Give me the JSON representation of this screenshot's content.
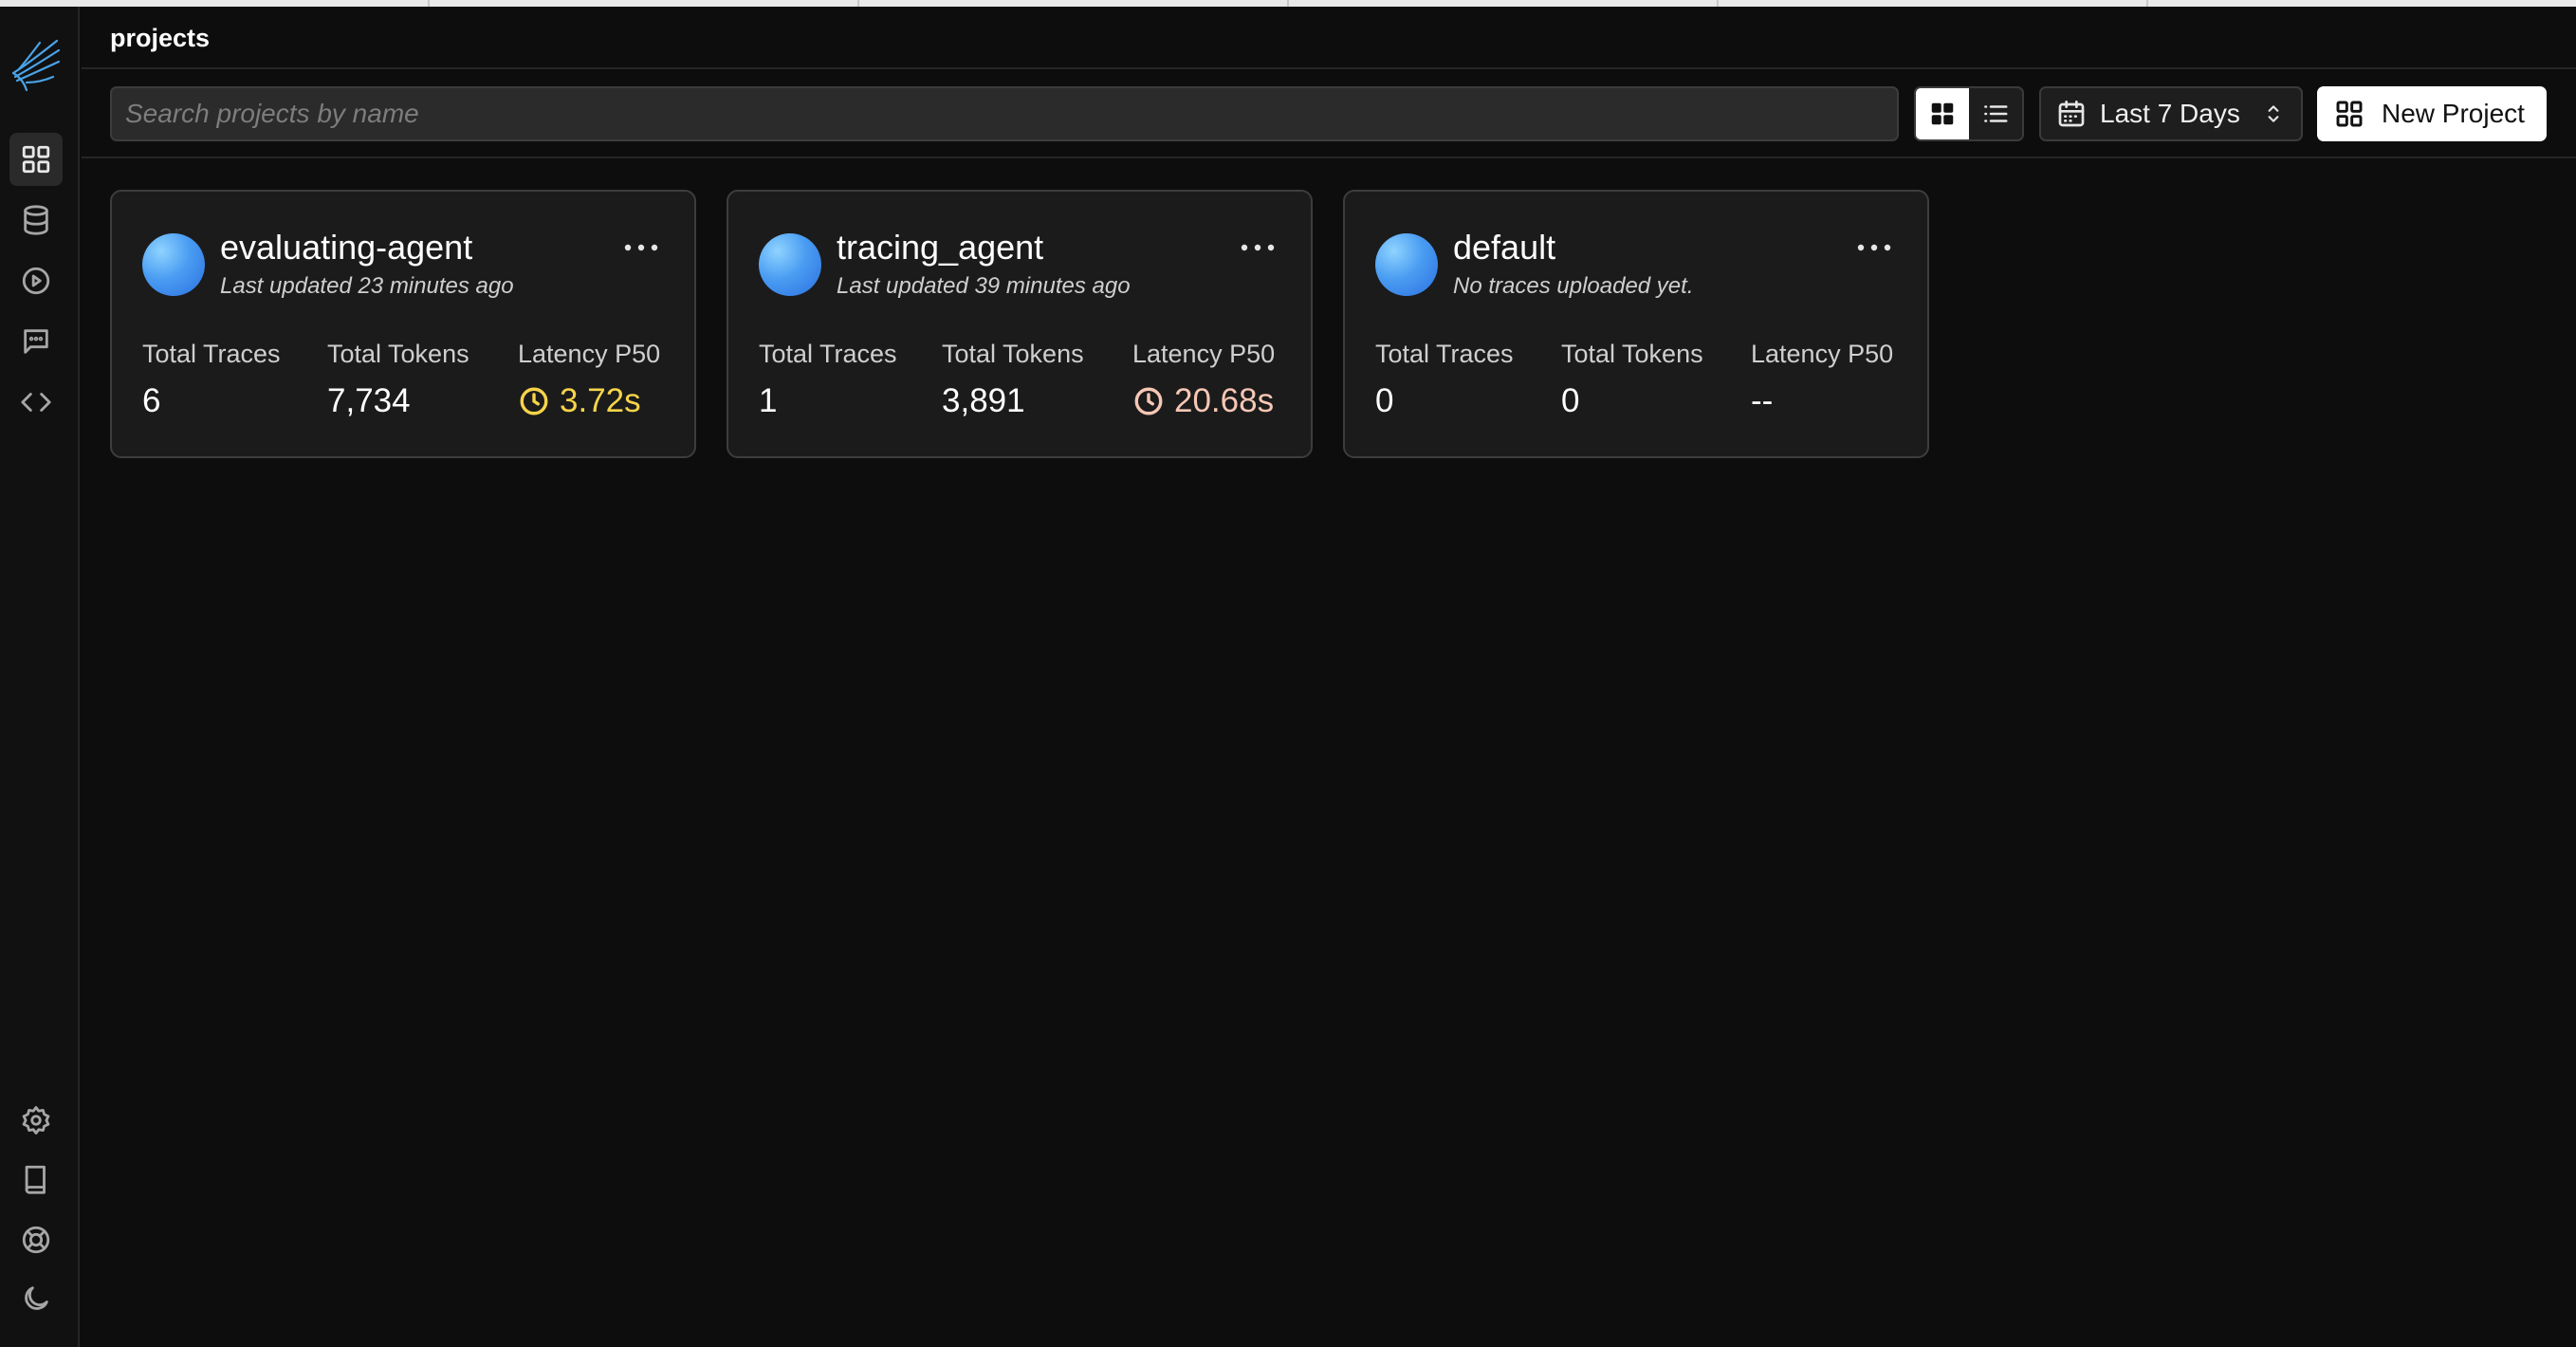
{
  "header": {
    "title": "projects"
  },
  "toolbar": {
    "search_placeholder": "Search projects by name",
    "search_value": "",
    "date_range": "Last 7 Days",
    "new_project_label": "New Project"
  },
  "sidebar": {
    "top_icons": [
      "grid-icon",
      "database-icon",
      "play-circle-icon",
      "message-icon",
      "code-icon"
    ],
    "bottom_icons": [
      "settings-icon",
      "book-icon",
      "lifebuoy-icon",
      "moon-icon"
    ]
  },
  "metric_labels": {
    "traces": "Total Traces",
    "tokens": "Total Tokens",
    "latency": "Latency P50"
  },
  "projects": [
    {
      "name": "evaluating-agent",
      "subtitle": "Last updated 23 minutes ago",
      "total_traces": "6",
      "total_tokens": "7,734",
      "latency": "3.72s",
      "latency_color": "#f6d44a"
    },
    {
      "name": "tracing_agent",
      "subtitle": "Last updated 39 minutes ago",
      "total_traces": "1",
      "total_tokens": "3,891",
      "latency": "20.68s",
      "latency_color": "#f7c7b5"
    },
    {
      "name": "default",
      "subtitle": "No traces uploaded yet.",
      "total_traces": "0",
      "total_tokens": "0",
      "latency": "--",
      "latency_color": "#ffffff"
    }
  ],
  "colors": {
    "background": "#0d0d0d",
    "card": "#1b1b1b",
    "accent_avatar": "#4a9df2"
  }
}
